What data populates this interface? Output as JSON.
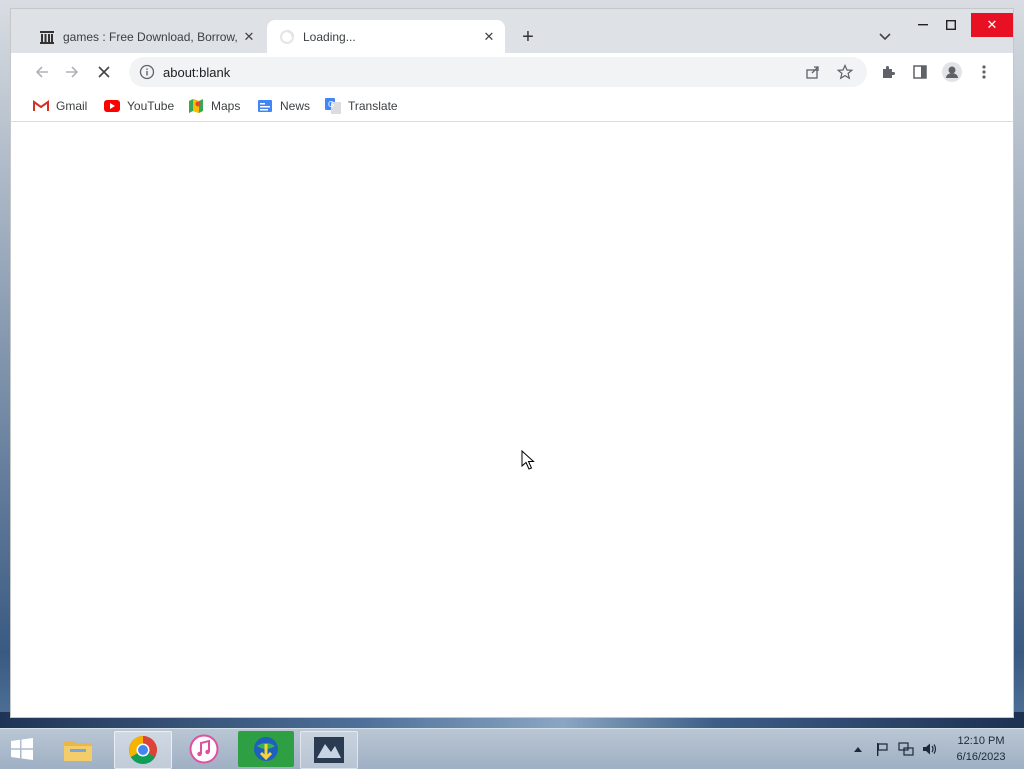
{
  "tabs": [
    {
      "title": "games : Free Download, Borrow, and Streaming : Internet Archive",
      "favicon": "archive-icon",
      "active": false
    },
    {
      "title": "Loading...",
      "favicon": "spinner-icon",
      "active": true
    }
  ],
  "toolbar": {
    "url": "about:blank"
  },
  "bookmarks": [
    {
      "label": "Gmail",
      "icon": "gmail-icon"
    },
    {
      "label": "YouTube",
      "icon": "youtube-icon"
    },
    {
      "label": "Maps",
      "icon": "maps-icon"
    },
    {
      "label": "News",
      "icon": "news-icon"
    },
    {
      "label": "Translate",
      "icon": "translate-icon"
    }
  ],
  "taskbar": {
    "apps": [
      "file-explorer-icon",
      "chrome-icon",
      "itunes-icon",
      "internet-download-manager-icon",
      "app-icon"
    ],
    "time": "12:10 PM",
    "date": "6/16/2023"
  },
  "colors": {
    "close_button": "#e81123",
    "tab_strip": "#dee1e6",
    "omnibox": "#f1f3f4"
  }
}
